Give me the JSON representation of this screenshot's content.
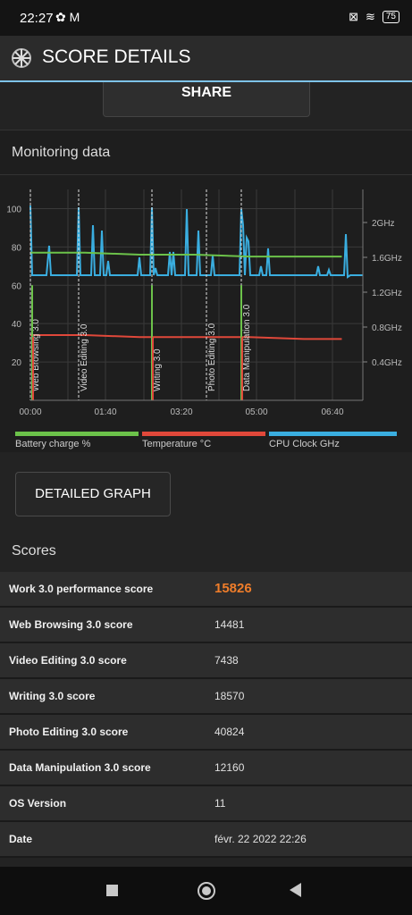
{
  "status": {
    "time": "22:27",
    "battery": "75"
  },
  "appbar": {
    "title": "SCORE DETAILS"
  },
  "share_label": "SHARE",
  "monitoring": {
    "title": "Monitoring data",
    "legend": [
      {
        "label": "Battery charge %",
        "color": "#6cc24a"
      },
      {
        "label": "Temperature °C",
        "color": "#e0483a"
      },
      {
        "label": "CPU Clock GHz",
        "color": "#3aaee0"
      }
    ]
  },
  "chart_data": {
    "type": "line",
    "x_ticks": [
      "00:00",
      "01:40",
      "03:20",
      "05:00",
      "06:40"
    ],
    "y_left_ticks": [
      "20",
      "40",
      "60",
      "80",
      "100"
    ],
    "y_right_ticks": [
      "0.4GHz",
      "0.8GHz",
      "1.2GHz",
      "1.6GHz",
      "2GHz"
    ],
    "annotations": [
      "Web Browsing 3.0",
      "Video Editing 3.0",
      "Writing 3.0",
      "Photo Editing 3.0",
      "Data Manipulation 3.0"
    ],
    "series": [
      {
        "name": "Battery charge %",
        "color": "#6cc24a",
        "x": [
          0,
          1.3,
          2.6,
          3.9,
          5.2,
          6.5,
          7.4
        ],
        "y": [
          77,
          77,
          76,
          76,
          75,
          75,
          75
        ]
      },
      {
        "name": "Temperature °C",
        "color": "#e0483a",
        "x": [
          0,
          1.3,
          2.6,
          3.9,
          5.2,
          6.5,
          7.4
        ],
        "y": [
          34,
          34,
          33,
          33,
          33,
          32,
          32
        ]
      }
    ]
  },
  "detail_graph_label": "DETAILED GRAPH",
  "scores": {
    "title": "Scores",
    "rows": [
      {
        "label": "Work 3.0 performance score",
        "value": "15826"
      },
      {
        "label": "Web Browsing 3.0 score",
        "value": "14481"
      },
      {
        "label": "Video Editing 3.0 score",
        "value": "7438"
      },
      {
        "label": "Writing 3.0 score",
        "value": "18570"
      },
      {
        "label": "Photo Editing 3.0 score",
        "value": "40824"
      },
      {
        "label": "Data Manipulation 3.0 score",
        "value": "12160"
      },
      {
        "label": "OS Version",
        "value": "11"
      },
      {
        "label": "Date",
        "value": "févr. 22 2022 22:26"
      }
    ]
  }
}
